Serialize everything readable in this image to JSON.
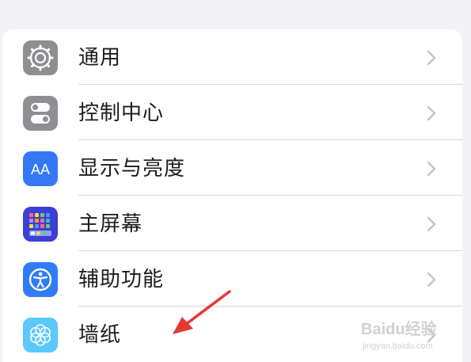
{
  "settings": {
    "items": [
      {
        "label": "通用",
        "icon": "gear-icon"
      },
      {
        "label": "控制中心",
        "icon": "control-center-icon"
      },
      {
        "label": "显示与亮度",
        "icon": "display-brightness-icon"
      },
      {
        "label": "主屏幕",
        "icon": "home-screen-icon"
      },
      {
        "label": "辅助功能",
        "icon": "accessibility-icon"
      },
      {
        "label": "墙纸",
        "icon": "wallpaper-icon"
      }
    ]
  },
  "icons": {
    "display_text": "AA"
  },
  "colors": {
    "page_bg": "#f2f2f7",
    "general_icon": "#8e8e93",
    "control_center_icon": "#8e8e93",
    "display_icon": "#3478f6",
    "home_screen_icon": "#3b3fd4",
    "accessibility_icon": "#2f7cf6",
    "wallpaper_icon": "#5ac8fa",
    "annotation_arrow": "#e53935"
  },
  "watermark": {
    "text": "Baidu经验",
    "url": "jingyan.baidu.com"
  }
}
